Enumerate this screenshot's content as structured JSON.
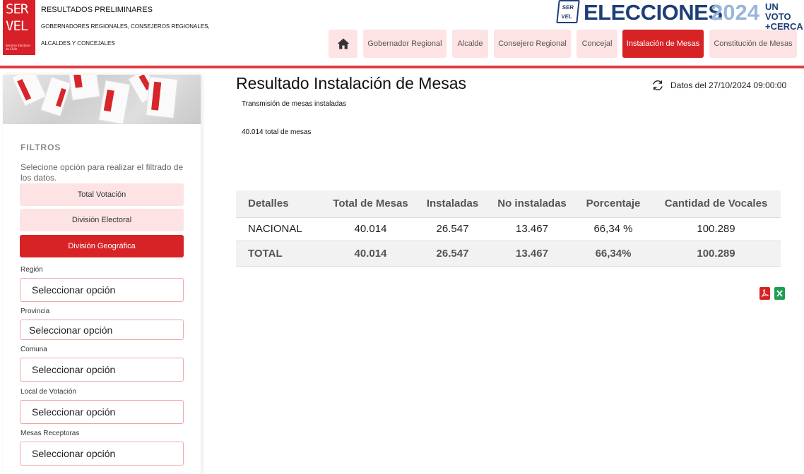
{
  "header": {
    "logo": {
      "line1": "SER",
      "line2": "VEL",
      "line3": "Servicio Electoral de Chile"
    },
    "title": "RESULTADOS PRELIMINARES",
    "subtitle1": "GOBERNADORES REGIONALES, CONSEJEROS REGIONALES,",
    "subtitle2": "ALCALDES Y CONCEJALES",
    "election_logo": {
      "badge_top": "SER",
      "badge_bottom": "VEL",
      "main": "ELECCIONES",
      "year": "2024",
      "tag_line1": "UN VOTO",
      "tag_line2": "+CERCA"
    }
  },
  "nav": {
    "items": [
      {
        "label": "Gobernador Regional",
        "active": false
      },
      {
        "label": "Alcalde",
        "active": false
      },
      {
        "label": "Consejero Regional",
        "active": false
      },
      {
        "label": "Concejal",
        "active": false
      },
      {
        "label": "Instalación de Mesas",
        "active": true
      },
      {
        "label": "Constitución de Mesas",
        "active": false
      }
    ]
  },
  "sidebar": {
    "filters_title": "FILTROS",
    "filters_desc": "Selecione opción para realizar el filtrado de los datos.",
    "buttons": [
      {
        "label": "Total Votación",
        "active": false
      },
      {
        "label": "División Electoral",
        "active": false
      },
      {
        "label": "División Geográfica",
        "active": true
      }
    ],
    "fields": [
      {
        "label": "Región",
        "value": "Seleccionar opción"
      },
      {
        "label": "Provincia",
        "value": "Seleccionar opción"
      },
      {
        "label": "Comuna",
        "value": "Seleccionar opción"
      },
      {
        "label": "Local de Votación",
        "value": "Seleccionar opción"
      },
      {
        "label": "Mesas Receptoras",
        "value": "Seleccionar opción"
      }
    ]
  },
  "main": {
    "title": "Resultado Instalación de Mesas",
    "update_text": "Datos del 27/10/2024 09:00:00",
    "subtitle": "Transmisión de mesas instaladas",
    "total_text": "40.014 total de mesas",
    "table": {
      "headers": [
        "Detalles",
        "Total de Mesas",
        "Instaladas",
        "No instaladas",
        "Porcentaje",
        "Cantidad de Vocales"
      ],
      "rows": [
        [
          "NACIONAL",
          "40.014",
          "26.547",
          "13.467",
          "66,34 %",
          "100.289"
        ]
      ],
      "total": [
        "TOTAL",
        "40.014",
        "26.547",
        "13.467",
        "66,34%",
        "100.289"
      ]
    }
  },
  "colors": {
    "brand_red": "#d82326",
    "light_pink": "#fde3e4",
    "navy": "#1d3f78",
    "light_blue": "#9ab6db",
    "excel_green": "#1f9d55"
  },
  "icons": [
    "home-icon",
    "refresh-icon",
    "pdf-icon",
    "excel-icon"
  ]
}
